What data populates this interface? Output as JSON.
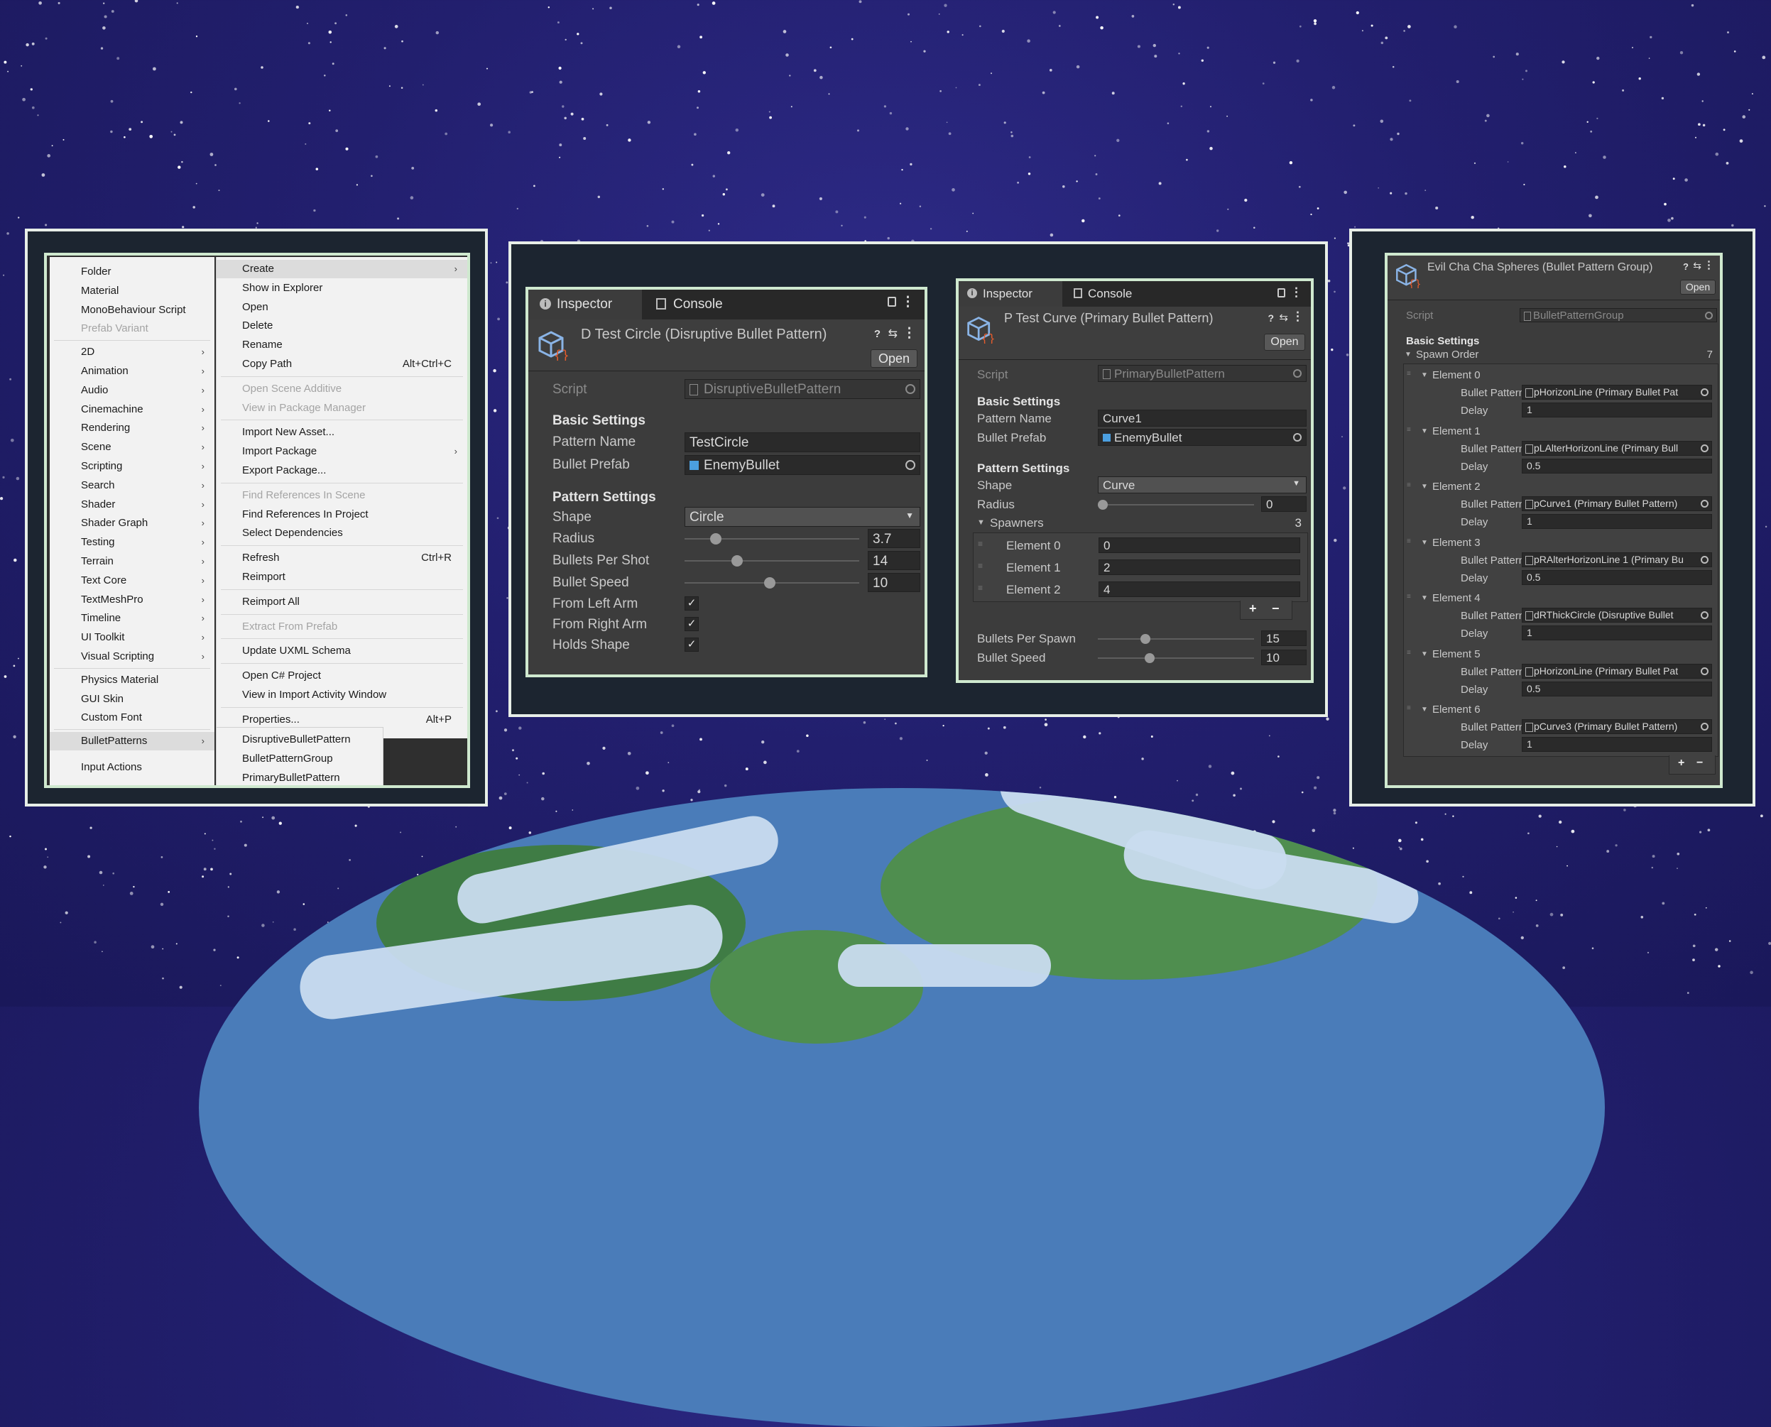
{
  "context_menu": {
    "left_items": [
      {
        "label": "Folder"
      },
      {
        "label": "Material"
      },
      {
        "label": "MonoBehaviour Script"
      },
      {
        "label": "Prefab Variant",
        "disabled": true
      },
      {
        "label": "2D",
        "sub": true
      },
      {
        "label": "Animation",
        "sub": true
      },
      {
        "label": "Audio",
        "sub": true
      },
      {
        "label": "Cinemachine",
        "sub": true
      },
      {
        "label": "Rendering",
        "sub": true
      },
      {
        "label": "Scene",
        "sub": true
      },
      {
        "label": "Scripting",
        "sub": true
      },
      {
        "label": "Search",
        "sub": true
      },
      {
        "label": "Shader",
        "sub": true
      },
      {
        "label": "Shader Graph",
        "sub": true
      },
      {
        "label": "Testing",
        "sub": true
      },
      {
        "label": "Terrain",
        "sub": true
      },
      {
        "label": "Text Core",
        "sub": true
      },
      {
        "label": "TextMeshPro",
        "sub": true
      },
      {
        "label": "Timeline",
        "sub": true
      },
      {
        "label": "UI Toolkit",
        "sub": true
      },
      {
        "label": "Visual Scripting",
        "sub": true
      },
      {
        "label": "Physics Material"
      },
      {
        "label": "GUI Skin"
      },
      {
        "label": "Custom Font"
      },
      {
        "label": "BulletPatterns",
        "sub": true,
        "selected": true
      },
      {
        "label": "Input Actions"
      }
    ],
    "right_items": [
      {
        "label": "Create",
        "sub": true,
        "selected": true
      },
      {
        "label": "Show in Explorer"
      },
      {
        "label": "Open"
      },
      {
        "label": "Delete"
      },
      {
        "label": "Rename"
      },
      {
        "label": "Copy Path",
        "shortcut": "Alt+Ctrl+C"
      },
      {
        "label": "Open Scene Additive",
        "disabled": true
      },
      {
        "label": "View in Package Manager",
        "disabled": true
      },
      {
        "label": "Import New Asset..."
      },
      {
        "label": "Import Package",
        "sub": true
      },
      {
        "label": "Export Package..."
      },
      {
        "label": "Find References In Scene",
        "disabled": true
      },
      {
        "label": "Find References In Project"
      },
      {
        "label": "Select Dependencies"
      },
      {
        "label": "Refresh",
        "shortcut": "Ctrl+R"
      },
      {
        "label": "Reimport"
      },
      {
        "label": "Reimport All"
      },
      {
        "label": "Extract From Prefab",
        "disabled": true
      },
      {
        "label": "Update UXML Schema"
      },
      {
        "label": "Open C# Project"
      },
      {
        "label": "View in Import Activity Window"
      },
      {
        "label": "Properties...",
        "shortcut": "Alt+P"
      }
    ],
    "submenu_items": [
      "DisruptiveBulletPattern",
      "BulletPatternGroup",
      "PrimaryBulletPattern"
    ]
  },
  "inspector_circle": {
    "tabs": [
      "Inspector",
      "Console"
    ],
    "title": "D Test Circle (Disruptive Bullet Pattern)",
    "open_label": "Open",
    "script_label": "Script",
    "script_value": "DisruptiveBulletPattern",
    "basic_heading": "Basic Settings",
    "pattern_name_label": "Pattern Name",
    "pattern_name_value": "TestCircle",
    "bullet_prefab_label": "Bullet Prefab",
    "bullet_prefab_value": "EnemyBullet",
    "pattern_heading": "Pattern Settings",
    "shape_label": "Shape",
    "shape_value": "Circle",
    "radius_label": "Radius",
    "radius_value": "3.7",
    "bps_label": "Bullets Per Shot",
    "bps_value": "14",
    "speed_label": "Bullet Speed",
    "speed_value": "10",
    "left_arm_label": "From Left Arm",
    "right_arm_label": "From Right Arm",
    "holds_label": "Holds Shape",
    "check_mark": "✓"
  },
  "inspector_curve": {
    "tabs": [
      "Inspector",
      "Console"
    ],
    "title": "P Test Curve (Primary Bullet Pattern)",
    "open_label": "Open",
    "script_label": "Script",
    "script_value": "PrimaryBulletPattern",
    "basic_heading": "Basic Settings",
    "pattern_name_label": "Pattern Name",
    "pattern_name_value": "Curve1",
    "bullet_prefab_label": "Bullet Prefab",
    "bullet_prefab_value": "EnemyBullet",
    "pattern_heading": "Pattern Settings",
    "shape_label": "Shape",
    "shape_value": "Curve",
    "radius_label": "Radius",
    "radius_value": "0",
    "spawners_label": "Spawners",
    "spawners_count": "3",
    "elements": [
      {
        "label": "Element 0",
        "value": "0"
      },
      {
        "label": "Element 1",
        "value": "2"
      },
      {
        "label": "Element 2",
        "value": "4"
      }
    ],
    "plus": "+",
    "minus": "−",
    "bps_label": "Bullets Per Spawn",
    "bps_value": "15",
    "speed_label": "Bullet Speed",
    "speed_value": "10"
  },
  "inspector_group": {
    "title": "Evil Cha Cha Spheres (Bullet Pattern Group)",
    "open_label": "Open",
    "script_label": "Script",
    "script_value": "BulletPatternGroup",
    "basic_heading": "Basic Settings",
    "spawn_order_label": "Spawn Order",
    "spawn_order_count": "7",
    "bullet_pattern_label": "Bullet Pattern",
    "delay_label": "Delay",
    "elements": [
      {
        "label": "Element 0",
        "pattern": "pHorizonLine (Primary Bullet Pat",
        "delay": "1"
      },
      {
        "label": "Element 1",
        "pattern": "pLAlterHorizonLine (Primary Bull",
        "delay": "0.5"
      },
      {
        "label": "Element 2",
        "pattern": "pCurve1 (Primary Bullet Pattern)",
        "delay": "1"
      },
      {
        "label": "Element 3",
        "pattern": "pRAlterHorizonLine 1 (Primary Bu",
        "delay": "0.5"
      },
      {
        "label": "Element 4",
        "pattern": "dRThickCircle (Disruptive Bullet",
        "delay": "1"
      },
      {
        "label": "Element 5",
        "pattern": "pHorizonLine (Primary Bullet Pat",
        "delay": "0.5"
      },
      {
        "label": "Element 6",
        "pattern": "pCurve3 (Primary Bullet Pattern)",
        "delay": "1"
      }
    ],
    "plus": "+",
    "minus": "−"
  },
  "colors": {
    "frame_border": "#cfe9cf",
    "panel_bg": "#3c3c3c",
    "menu_bg": "#f2f2f2",
    "space": "#221f6e"
  }
}
